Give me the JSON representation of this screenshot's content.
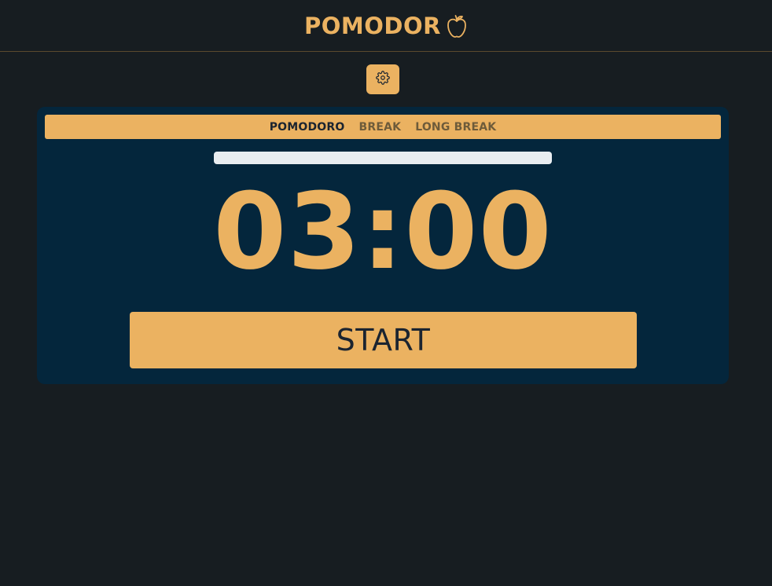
{
  "header": {
    "title": "POMODOR",
    "logo_icon": "apple-icon"
  },
  "settings": {
    "icon": "gear-icon"
  },
  "tabs": [
    {
      "label": "POMODORO",
      "active": true
    },
    {
      "label": "BREAK",
      "active": false
    },
    {
      "label": "LONG BREAK",
      "active": false
    }
  ],
  "progress": {
    "fraction": 0
  },
  "timer": {
    "display": "03:00"
  },
  "start_button": {
    "label": "START"
  },
  "colors": {
    "background": "#171d21",
    "card": "#04263c",
    "accent": "#ebb261",
    "dark_text": "#1b2430",
    "track": "#e9edf1"
  }
}
